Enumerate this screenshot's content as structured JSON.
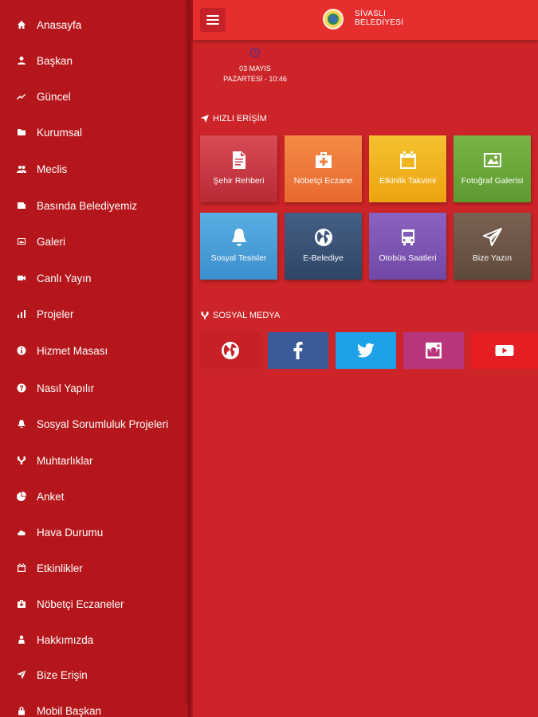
{
  "sidebar": {
    "items": [
      {
        "label": "Anasayfa",
        "icon": "home-icon"
      },
      {
        "label": "Başkan",
        "icon": "user-icon"
      },
      {
        "label": "Güncel",
        "icon": "trend-icon"
      },
      {
        "label": "Kurumsal",
        "icon": "folder-icon"
      },
      {
        "label": "Meclis",
        "icon": "group-icon"
      },
      {
        "label": "Basında Belediyemiz",
        "icon": "newspaper-icon"
      },
      {
        "label": "Galeri",
        "icon": "gallery-icon"
      },
      {
        "label": "Canlı Yayın",
        "icon": "video-icon"
      },
      {
        "label": "Projeler",
        "icon": "bar-chart-icon"
      },
      {
        "label": "Hizmet Masası",
        "icon": "info-icon"
      },
      {
        "label": "Nasıl Yapılır",
        "icon": "question-icon"
      },
      {
        "label": "Sosyal Sorumluluk Projeleri",
        "icon": "bell-icon"
      },
      {
        "label": "Muhtarlıklar",
        "icon": "branch-icon"
      },
      {
        "label": "Anket",
        "icon": "pie-chart-icon"
      },
      {
        "label": "Hava Durumu",
        "icon": "cloud-icon"
      },
      {
        "label": "Etkinlikler",
        "icon": "calendar-icon"
      },
      {
        "label": "Nöbetçi Eczaneler",
        "icon": "medkit-icon"
      },
      {
        "label": "Hakkımızda",
        "icon": "person-icon"
      },
      {
        "label": "Bize Erişin",
        "icon": "send-icon"
      },
      {
        "label": "Mobil Başkan",
        "icon": "lock-icon"
      }
    ]
  },
  "header": {
    "brand_line1": "SİVASLI",
    "brand_line2": "BELEDİYESİ"
  },
  "date": {
    "line1": "03 MAYIS",
    "line2": "PAZARTESİ - 10:46"
  },
  "quick_access": {
    "title": "HIZLI ERİŞİM",
    "tiles": [
      {
        "label": "Şehir Rehberi",
        "icon": "document-icon",
        "color": "#d03a45"
      },
      {
        "label": "Nöbetçi Eczane",
        "icon": "medkit-icon",
        "color": "#f07a3a"
      },
      {
        "label": "Etkinlik Takvimi",
        "icon": "calendar-icon",
        "color": "#f0b21e"
      },
      {
        "label": "Fotoğraf Galerisi",
        "icon": "image-icon",
        "color": "#6aa83a"
      },
      {
        "label": "Sosyal Tesisler",
        "icon": "bell-icon",
        "color": "#4aa0d8"
      },
      {
        "label": "E-Belediye",
        "icon": "globe-icon",
        "color": "#3a5275"
      },
      {
        "label": "Otobüs Saatleri",
        "icon": "bus-icon",
        "color": "#7e55b0"
      },
      {
        "label": "Bize Yazın",
        "icon": "send-icon",
        "color": "#6b5446"
      }
    ]
  },
  "social_media": {
    "title": "SOSYAL MEDYA",
    "items": [
      {
        "icon": "globe-icon",
        "color": "#c62126"
      },
      {
        "icon": "facebook-icon",
        "color": "#3b5a9a"
      },
      {
        "icon": "twitter-icon",
        "color": "#1da1e8"
      },
      {
        "icon": "instagram-icon",
        "color": "#b8357c"
      },
      {
        "icon": "youtube-icon",
        "color": "#e41e22"
      }
    ]
  }
}
